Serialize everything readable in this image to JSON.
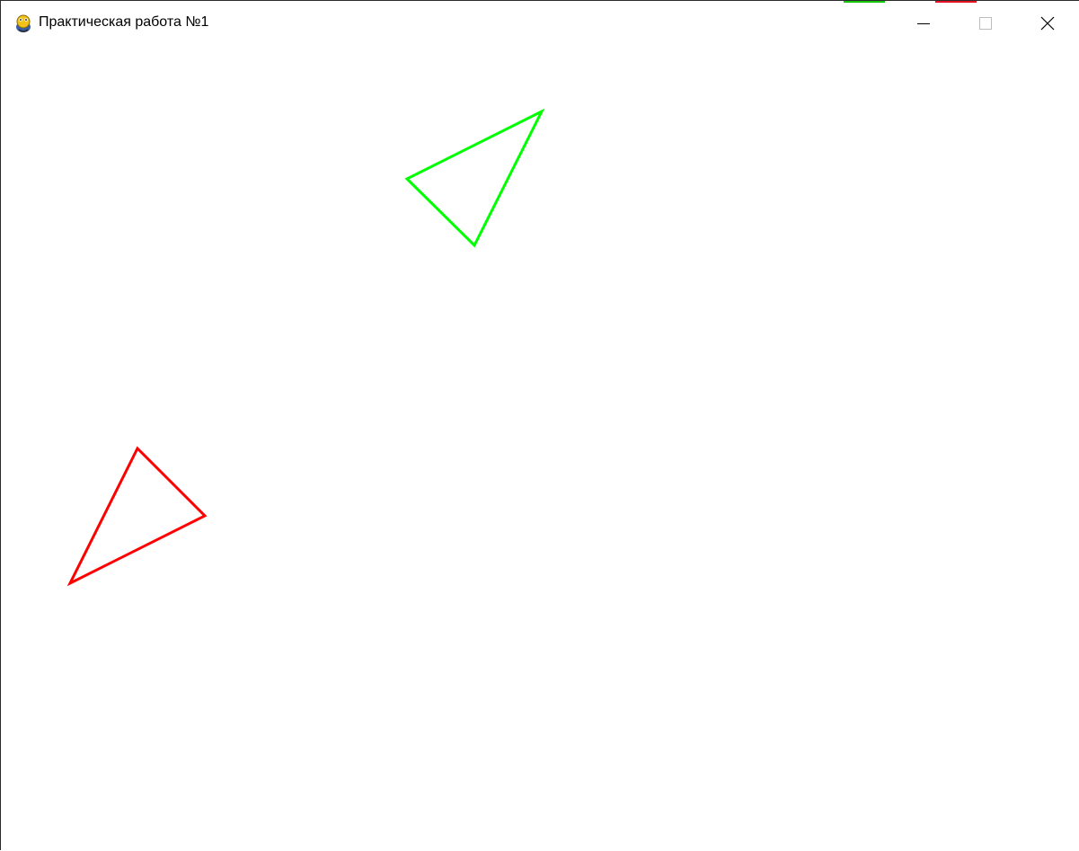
{
  "window": {
    "title": "Практическая работа №1",
    "app_icon": "pygame-snake-icon",
    "controls": [
      "minimize-icon",
      "maximize-icon",
      "close-icon"
    ]
  },
  "canvas": {
    "background": "#ffffff",
    "shapes": [
      {
        "name": "green-triangle",
        "color": "#00ff00"
      },
      {
        "name": "red-triangle",
        "color": "#ff0000"
      }
    ]
  },
  "colors": {
    "taskbar_green": "#16c60c",
    "taskbar_red": "#e81123"
  }
}
